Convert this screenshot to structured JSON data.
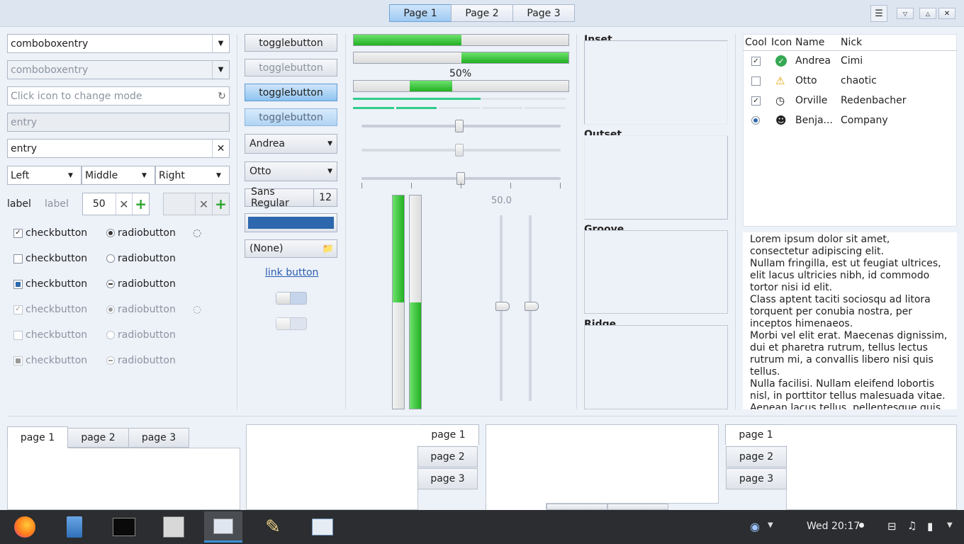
{
  "stack": {
    "tabs": [
      "Page 1",
      "Page 2",
      "Page 3"
    ]
  },
  "left": {
    "combo1": "comboboxentry",
    "combo2": "comboboxentry",
    "entry_placeholder": "Click icon to change mode",
    "entry_disabled": "entry",
    "entry_clear": "entry",
    "segments": [
      "Left",
      "Middle",
      "Right"
    ],
    "label1": "label",
    "label2": "label",
    "spin_value": "50",
    "check_label": "checkbutton",
    "radio_label": "radiobutton"
  },
  "buttons": {
    "toggle": "togglebutton",
    "combo_andrea": "Andrea",
    "combo_otto": "Otto",
    "font_name": "Sans Regular",
    "font_size": "12",
    "color": "#2d67ad",
    "file": "(None)",
    "link": "link button"
  },
  "progress": {
    "label": "50%",
    "scale_value": "50.0",
    "bar1": 0.5,
    "bar2": 0.5,
    "bar3": 0.5
  },
  "frames": [
    "Inset",
    "Outset",
    "Groove",
    "Ridge"
  ],
  "tree": {
    "headers": [
      "Cool",
      "Icon",
      "Name",
      "Nick"
    ],
    "rows": [
      {
        "name": "Andrea",
        "nick": "Cimi"
      },
      {
        "name": "Otto",
        "nick": "chaotic"
      },
      {
        "name": "Orville",
        "nick": "Redenbacher"
      },
      {
        "name": "Benja...",
        "nick": "Company"
      }
    ]
  },
  "textview": [
    "Lorem ipsum dolor sit amet, consectetur adipiscing elit.",
    "Nullam fringilla, est ut feugiat ultrices, elit lacus ultricies nibh, id commodo tortor nisi id elit.",
    "Class aptent taciti sociosqu ad litora torquent per conubia nostra, per inceptos himenaeos.",
    "Morbi vel elit erat. Maecenas dignissim, dui et pharetra rutrum, tellus lectus rutrum mi, a convallis libero nisi quis tellus.",
    "Nulla facilisi. Nullam eleifend lobortis nisl, in porttitor tellus malesuada vitae.",
    "Aenean lacus tellus, pellentesque quis"
  ],
  "notebooks": {
    "tabs": [
      "page 1",
      "page 2",
      "page 3"
    ]
  },
  "taskbar": {
    "clock": "Wed 20:17"
  },
  "colors": {
    "accent": "#3b8fd9",
    "progress": "#22b022",
    "color_button": "#2d67ad"
  }
}
